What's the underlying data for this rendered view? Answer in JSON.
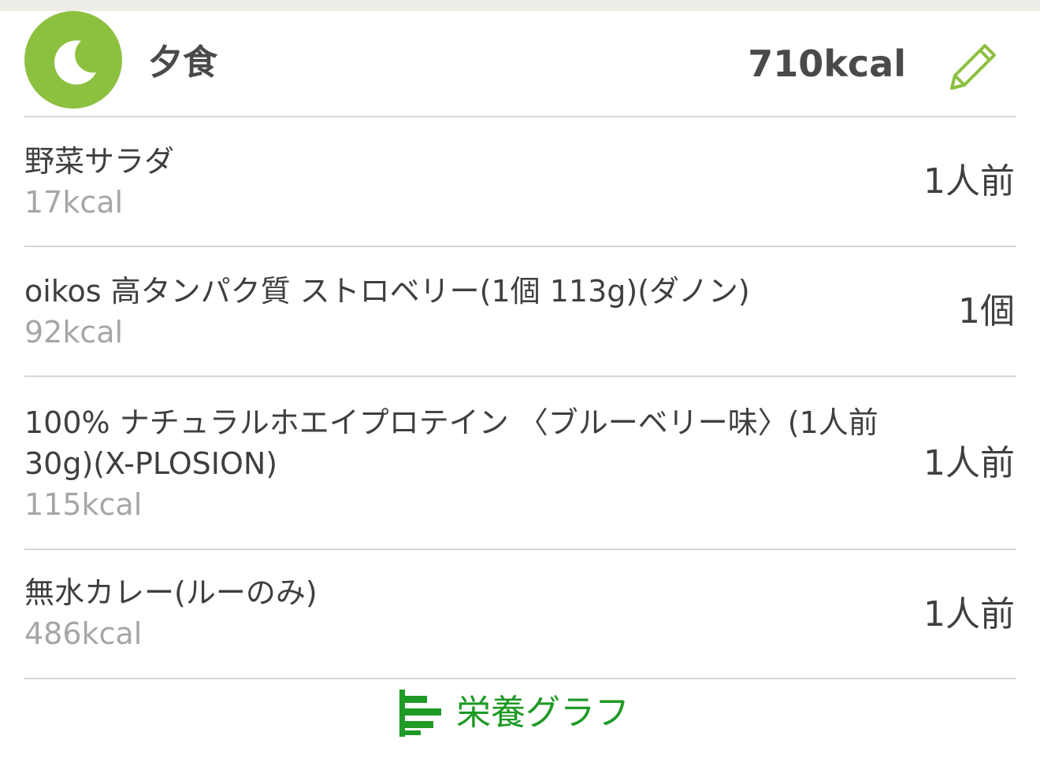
{
  "meal": {
    "icon": "moon-icon",
    "title": "夕食",
    "total_kcal": "710kcal",
    "edit_icon": "pencil-icon"
  },
  "items": [
    {
      "name": "野菜サラダ",
      "kcal": "17kcal",
      "qty": "1人前"
    },
    {
      "name": "oikos 高タンパク質 ストロベリー(1個 113g)(ダノン)",
      "kcal": "92kcal",
      "qty": "1個"
    },
    {
      "name": "100% ナチュラルホエイプロテイン 〈ブルーベリー味〉(1人前 30g)(X-PLOSION)",
      "kcal": "115kcal",
      "qty": "1人前"
    },
    {
      "name": "無水カレー(ルーのみ)",
      "kcal": "486kcal",
      "qty": "1人前"
    }
  ],
  "footer": {
    "graph_label": "栄養グラフ",
    "graph_icon": "bar-chart-icon"
  },
  "colors": {
    "accent_green": "#8cc03f",
    "link_green": "#1f9a26",
    "text": "#3f3f3f",
    "muted": "#a6a6a6"
  }
}
